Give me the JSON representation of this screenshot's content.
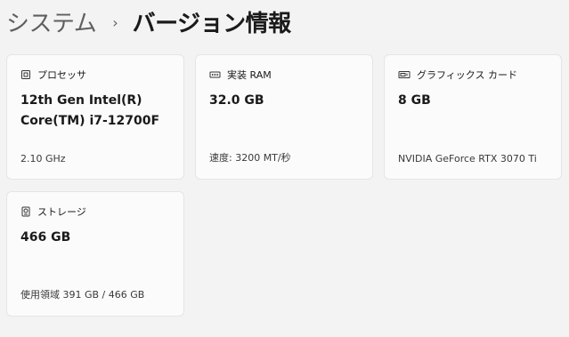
{
  "breadcrumb": {
    "parent": "システム",
    "separator": "›",
    "current": "バージョン情報"
  },
  "specs": {
    "processor": {
      "icon": "cpu-icon",
      "title": "プロセッサ",
      "value": "12th Gen Intel(R) Core(TM) i7-12700F",
      "detail": "2.10 GHz"
    },
    "memory": {
      "icon": "ram-icon",
      "title": "実装 RAM",
      "value": "32.0 GB",
      "detail": "速度: 3200 MT/秒"
    },
    "graphics": {
      "icon": "graphics-card-icon",
      "title": "グラフィックス カード",
      "value": "8 GB",
      "detail": "NVIDIA GeForce RTX 3070 Ti"
    },
    "storage": {
      "icon": "hard-drive-icon",
      "title": "ストレージ",
      "value": "466 GB",
      "detail": "使用領域 391 GB / 466 GB"
    }
  }
}
